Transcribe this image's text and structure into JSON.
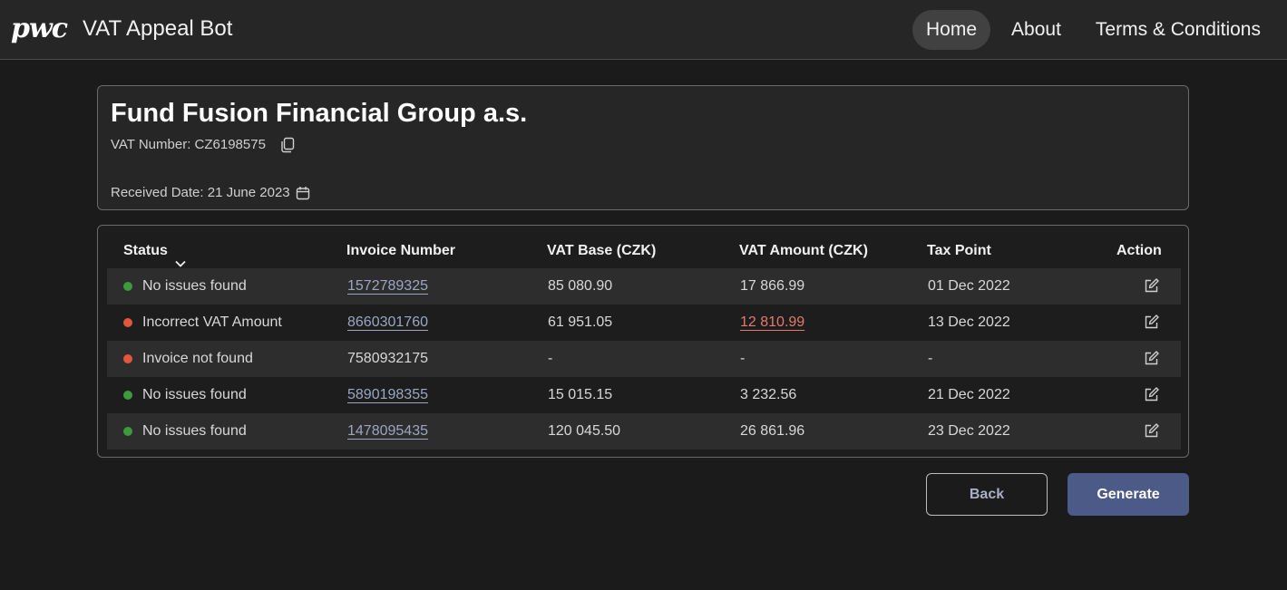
{
  "header": {
    "logo_text": "pwc",
    "app_title": "VAT Appeal Bot",
    "nav": [
      {
        "label": "Home",
        "active": true
      },
      {
        "label": "About",
        "active": false
      },
      {
        "label": "Terms & Conditions",
        "active": false
      }
    ]
  },
  "company": {
    "name": "Fund Fusion Financial Group a.s.",
    "vat_number_text": "VAT Number: CZ6198575",
    "received_date_text": "Received Date: 21 June 2023"
  },
  "table": {
    "headers": {
      "status": "Status",
      "invoice_number": "Invoice Number",
      "vat_base": "VAT Base (CZK)",
      "vat_amount": "VAT Amount (CZK)",
      "tax_point": "Tax Point",
      "action": "Action"
    },
    "rows": [
      {
        "status": "No issues found",
        "status_color": "#3d9a3d",
        "invoice_number": "1572789325",
        "invoice_linked": true,
        "vat_base": "85 080.90",
        "vat_amount": "17 866.99",
        "vat_amount_error": false,
        "tax_point": "01 Dec 2022"
      },
      {
        "status": "Incorrect VAT Amount",
        "status_color": "#e0573e",
        "invoice_number": "8660301760",
        "invoice_linked": true,
        "vat_base": "61 951.05",
        "vat_amount": "12 810.99",
        "vat_amount_error": true,
        "tax_point": "13 Dec 2022"
      },
      {
        "status": "Invoice not found",
        "status_color": "#e0573e",
        "invoice_number": "7580932175",
        "invoice_linked": false,
        "vat_base": "-",
        "vat_amount": "-",
        "vat_amount_error": false,
        "tax_point": "-"
      },
      {
        "status": "No issues found",
        "status_color": "#3d9a3d",
        "invoice_number": "5890198355",
        "invoice_linked": true,
        "vat_base": "15 015.15",
        "vat_amount": "3 232.56",
        "vat_amount_error": false,
        "tax_point": "21 Dec 2022"
      },
      {
        "status": "No issues found",
        "status_color": "#3d9a3d",
        "invoice_number": "1478095435",
        "invoice_linked": true,
        "vat_base": "120 045.50",
        "vat_amount": "26 861.96",
        "vat_amount_error": false,
        "tax_point": "23 Dec 2022"
      }
    ]
  },
  "buttons": {
    "back": "Back",
    "generate": "Generate"
  },
  "colors": {
    "accent": "#4b5a86",
    "ok": "#3d9a3d",
    "error": "#e0573e",
    "link": "#9aa6c4"
  },
  "icons": {
    "copy": "copy-icon",
    "calendar": "calendar-icon",
    "sort": "chevron-down-icon",
    "edit": "edit-icon"
  }
}
